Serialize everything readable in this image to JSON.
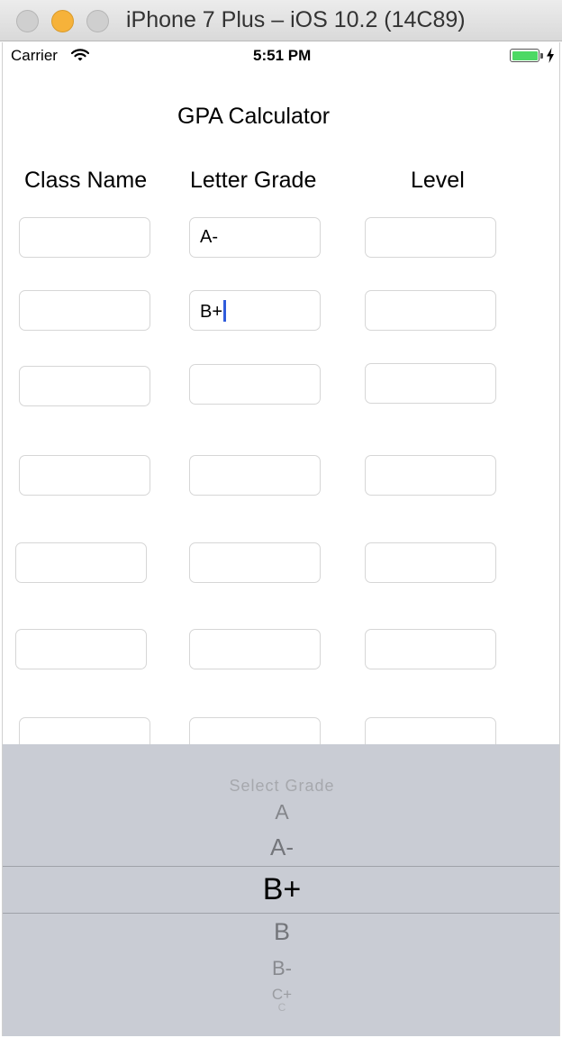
{
  "window": {
    "title": "iPhone 7 Plus – iOS 10.2 (14C89)"
  },
  "status_bar": {
    "carrier": "Carrier",
    "time": "5:51 PM"
  },
  "app": {
    "title": "GPA Calculator",
    "columns": {
      "class_name": "Class Name",
      "letter_grade": "Letter Grade",
      "level": "Level"
    },
    "rows": [
      {
        "class_name": "",
        "letter_grade": "A-",
        "level": ""
      },
      {
        "class_name": "",
        "letter_grade": "B+",
        "level": ""
      },
      {
        "class_name": "",
        "letter_grade": "",
        "level": ""
      },
      {
        "class_name": "",
        "letter_grade": "",
        "level": ""
      },
      {
        "class_name": "",
        "letter_grade": "",
        "level": ""
      },
      {
        "class_name": "",
        "letter_grade": "",
        "level": ""
      },
      {
        "class_name": "",
        "letter_grade": "",
        "level": ""
      }
    ]
  },
  "picker": {
    "prompt": "Select Grade",
    "options": [
      "A",
      "A-",
      "B+",
      "B",
      "B-",
      "C+",
      "C"
    ],
    "selected": "B+"
  },
  "colors": {
    "picker_background": "#c9ccd4",
    "caret": "#2f5bdb",
    "battery": "#4cd964",
    "minimize_button": "#f6b23a"
  },
  "icons": [
    "close-button",
    "minimize-button",
    "zoom-button",
    "wifi-icon",
    "battery-icon",
    "charging-bolt-icon"
  ]
}
